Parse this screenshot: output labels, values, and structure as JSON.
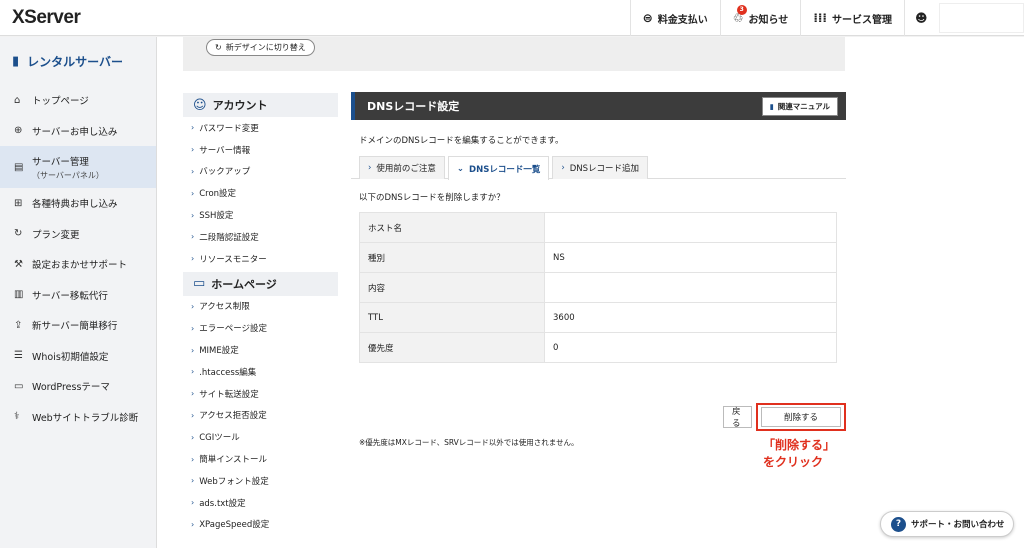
{
  "header": {
    "logo": "XServer",
    "nav": [
      {
        "icon": "yen-icon",
        "glyph": "⊜",
        "label": "料金支払い"
      },
      {
        "icon": "bell-icon",
        "glyph": "🔔",
        "label": "お知らせ",
        "badge": "3"
      },
      {
        "icon": "grid-icon",
        "glyph": "⁞⁞⁞",
        "label": "サービス管理"
      }
    ],
    "account_icon": "user-icon"
  },
  "sidebar": {
    "title": "レンタルサーバー",
    "items": [
      {
        "label": "トップページ",
        "glyph": "⌂"
      },
      {
        "label": "サーバーお申し込み",
        "glyph": "⊕"
      },
      {
        "label": "サーバー管理",
        "sub": "（サーバーパネル）",
        "glyph": "▤"
      },
      {
        "label": "各種特典お申し込み",
        "glyph": "⊞"
      },
      {
        "label": "プラン変更",
        "glyph": "↻"
      },
      {
        "label": "設定おまかせサポート",
        "glyph": "⚒"
      },
      {
        "label": "サーバー移転代行",
        "glyph": "▥"
      },
      {
        "label": "新サーバー簡単移行",
        "glyph": "⇪"
      },
      {
        "label": "Whois初期値設定",
        "glyph": "☰"
      },
      {
        "label": "WordPressテーマ",
        "glyph": "▭"
      },
      {
        "label": "Webサイトトラブル診断",
        "glyph": "⚕"
      }
    ]
  },
  "switch_design": "新デザインに切り替え",
  "left_menu": {
    "account": {
      "title": "アカウント",
      "items": [
        "パスワード変更",
        "サーバー情報",
        "バックアップ",
        "Cron設定",
        "SSH設定",
        "二段階認証設定",
        "リソースモニター"
      ]
    },
    "homepage": {
      "title": "ホームページ",
      "items": [
        "アクセス制限",
        "エラーページ設定",
        "MIME設定",
        ".htaccess編集",
        "サイト転送設定",
        "アクセス拒否設定",
        "CGIツール",
        "簡単インストール",
        "Webフォント設定",
        "ads.txt設定",
        "XPageSpeed設定"
      ]
    }
  },
  "panel": {
    "title": "DNSレコード設定",
    "manual": "関連マニュアル",
    "desc": "ドメインのDNSレコードを編集することができます。",
    "tabs": [
      "使用前のご注意",
      "DNSレコード一覧",
      "DNSレコード追加"
    ],
    "confirm": "以下のDNSレコードを削除しますか？",
    "rows": [
      {
        "label": "ホスト名",
        "value": ""
      },
      {
        "label": "種別",
        "value": "NS"
      },
      {
        "label": "内容",
        "value": ""
      },
      {
        "label": "TTL",
        "value": "3600"
      },
      {
        "label": "優先度",
        "value": "0"
      }
    ],
    "back": "戻る",
    "delete": "削除する",
    "note": "※優先度はMXレコード、SRVレコード以外では使用されません。",
    "annotation": "「削除する」をクリック"
  },
  "support": "サポート・お問い合わせ",
  "colors": {
    "accent": "#1c4f8c",
    "highlight": "#e0301e"
  }
}
